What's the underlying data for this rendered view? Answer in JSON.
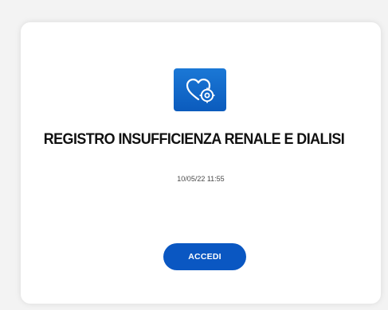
{
  "card": {
    "icon": "heart-gear-icon",
    "title": "REGISTRO INSUFFICIENZA RENALE E DIALISI",
    "timestamp": "10/05/22 11:55",
    "button_label": "ACCEDI"
  },
  "colors": {
    "icon_background": "#0b5bbd",
    "button_background": "#0a57c2"
  }
}
